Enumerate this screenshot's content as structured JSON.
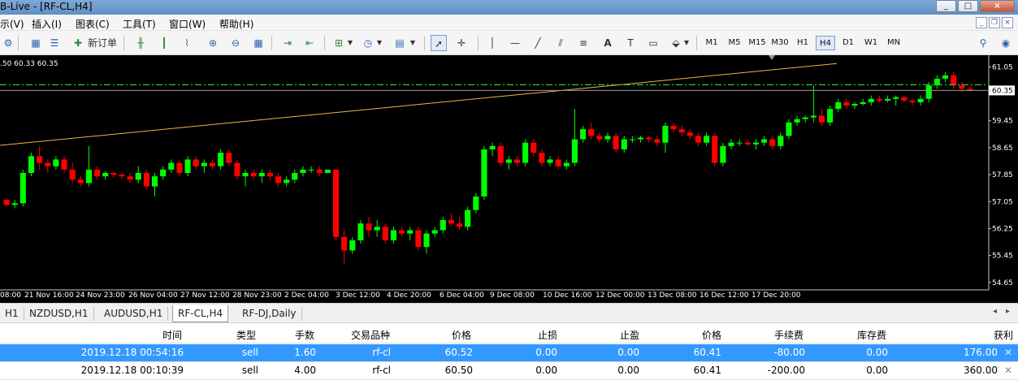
{
  "window": {
    "title": "B-Live - [RF-CL,H4]",
    "controls": [
      "_",
      "□",
      "×"
    ]
  },
  "menu": {
    "items": [
      "示(V)",
      "插入(I)",
      "图表(C)",
      "工具(T)",
      "窗口(W)",
      "帮助(H)"
    ]
  },
  "toolbar": {
    "new_order_label": "新订单",
    "timeframes": [
      "M1",
      "M5",
      "M15",
      "M30",
      "H1",
      "H4",
      "D1",
      "W1",
      "MN"
    ],
    "active_timeframe": "H4"
  },
  "chart": {
    "symbol": "RF-CL",
    "timeframe": "H4",
    "info_text": ".50 60.33 60.35",
    "current_price_label": "60.35",
    "y_ticks": [
      "61.05",
      "60.35",
      "59.45",
      "58.65",
      "57.85",
      "57.05",
      "56.25",
      "55.45",
      "54.65"
    ],
    "x_ticks": [
      "08:00",
      "21 Nov 16:00",
      "24 Nov 23:00",
      "26 Nov 04:00",
      "27 Nov 12:00",
      "28 Nov 23:00",
      "2 Dec 04:00",
      "3 Dec 12:00",
      "4 Dec 20:00",
      "6 Dec 04:00",
      "9 Dec 08:00",
      "10 Dec 16:00",
      "12 Dec 00:00",
      "13 Dec 08:00",
      "16 Dec 12:00",
      "17 Dec 20:00"
    ],
    "colors": {
      "background": "#000000",
      "bull": "#00ff00",
      "bear": "#ff0000",
      "trendline": "#e6b84a",
      "level_line": "#2ec72e"
    }
  },
  "chart_tabs": {
    "items": [
      "H1",
      "NZDUSD,H1",
      "AUDUSD,H1",
      "RF-CL,H4",
      "RF-DJ,Daily"
    ],
    "active": "RF-CL,H4"
  },
  "trades": {
    "columns": [
      "时间",
      "类型",
      "手数",
      "交易品种",
      "价格",
      "止损",
      "止盈",
      "价格",
      "手续费",
      "库存费",
      "获利"
    ],
    "rows": [
      {
        "time": "2019.12.18 00:54:16",
        "type": "sell",
        "lots": "1.60",
        "symbol": "rf-cl",
        "price": "60.52",
        "sl": "0.00",
        "tp": "0.00",
        "cur_price": "60.41",
        "commission": "-80.00",
        "swap": "0.00",
        "profit": "176.00"
      },
      {
        "time": "2019.12.18 00:10:39",
        "type": "sell",
        "lots": "4.00",
        "symbol": "rf-cl",
        "price": "60.50",
        "sl": "0.00",
        "tp": "0.00",
        "cur_price": "60.41",
        "commission": "-200.00",
        "swap": "0.00",
        "profit": "360.00"
      }
    ]
  },
  "chart_data": {
    "type": "candlestick",
    "symbol": "RF-CL",
    "timeframe": "H4",
    "ylim": [
      54.5,
      61.3
    ],
    "candles": [
      [
        57.1,
        57.15,
        56.9,
        56.95
      ],
      [
        56.95,
        57.1,
        56.85,
        57.0
      ],
      [
        57.0,
        58.0,
        56.9,
        57.9
      ],
      [
        57.9,
        58.5,
        57.8,
        58.4
      ],
      [
        58.4,
        58.7,
        58.0,
        58.2
      ],
      [
        58.2,
        58.3,
        57.9,
        58.1
      ],
      [
        58.1,
        58.4,
        58.0,
        58.3
      ],
      [
        58.3,
        58.4,
        57.9,
        58.0
      ],
      [
        58.0,
        58.2,
        57.6,
        57.7
      ],
      [
        57.7,
        57.8,
        57.5,
        57.6
      ],
      [
        57.6,
        58.7,
        57.5,
        58.0
      ],
      [
        58.0,
        58.1,
        57.7,
        57.8
      ],
      [
        57.8,
        57.95,
        57.7,
        57.9
      ],
      [
        57.9,
        57.95,
        57.75,
        57.85
      ],
      [
        57.85,
        57.9,
        57.7,
        57.8
      ],
      [
        57.8,
        57.9,
        57.6,
        57.7
      ],
      [
        57.7,
        58.1,
        57.6,
        57.9
      ],
      [
        57.9,
        58.0,
        57.4,
        57.5
      ],
      [
        57.5,
        57.9,
        57.2,
        57.8
      ],
      [
        57.8,
        58.1,
        57.7,
        58.0
      ],
      [
        58.0,
        58.3,
        57.9,
        58.2
      ],
      [
        58.2,
        58.3,
        57.8,
        57.9
      ],
      [
        57.9,
        58.4,
        57.8,
        58.3
      ],
      [
        58.3,
        58.4,
        58.0,
        58.1
      ],
      [
        58.1,
        58.3,
        57.9,
        58.2
      ],
      [
        58.2,
        58.3,
        58.0,
        58.1
      ],
      [
        58.1,
        58.6,
        58.0,
        58.5
      ],
      [
        58.5,
        58.6,
        58.1,
        58.2
      ],
      [
        58.2,
        58.3,
        57.7,
        57.8
      ],
      [
        57.8,
        58.0,
        57.5,
        57.9
      ],
      [
        57.9,
        58.0,
        57.7,
        57.8
      ],
      [
        57.8,
        58.0,
        57.6,
        57.9
      ],
      [
        57.9,
        58.0,
        57.7,
        57.8
      ],
      [
        57.8,
        57.9,
        57.5,
        57.6
      ],
      [
        57.6,
        57.8,
        57.5,
        57.7
      ],
      [
        57.7,
        58.0,
        57.6,
        57.9
      ],
      [
        57.9,
        58.1,
        57.8,
        58.0
      ],
      [
        58.0,
        58.1,
        57.9,
        58.0
      ],
      [
        58.0,
        58.1,
        57.8,
        57.9
      ],
      [
        57.9,
        58.0,
        57.9,
        58.0
      ],
      [
        58.0,
        58.0,
        55.9,
        56.0
      ],
      [
        56.0,
        56.2,
        55.2,
        55.6
      ],
      [
        55.6,
        56.0,
        55.5,
        55.9
      ],
      [
        55.9,
        56.5,
        55.8,
        56.4
      ],
      [
        56.4,
        56.6,
        56.0,
        56.2
      ],
      [
        56.2,
        56.5,
        56.0,
        56.3
      ],
      [
        56.3,
        56.4,
        55.8,
        55.9
      ],
      [
        55.9,
        56.3,
        55.8,
        56.2
      ],
      [
        56.2,
        56.3,
        56.0,
        56.1
      ],
      [
        56.1,
        56.3,
        55.9,
        56.2
      ],
      [
        56.2,
        56.3,
        55.6,
        55.7
      ],
      [
        55.7,
        56.2,
        55.5,
        56.1
      ],
      [
        56.1,
        56.3,
        56.0,
        56.2
      ],
      [
        56.2,
        56.6,
        56.1,
        56.5
      ],
      [
        56.5,
        56.7,
        56.3,
        56.4
      ],
      [
        56.4,
        56.6,
        56.2,
        56.3
      ],
      [
        56.3,
        56.9,
        56.2,
        56.8
      ],
      [
        56.8,
        57.3,
        56.7,
        57.2
      ],
      [
        57.2,
        58.7,
        57.1,
        58.6
      ],
      [
        58.6,
        58.8,
        58.4,
        58.7
      ],
      [
        58.7,
        58.8,
        58.1,
        58.2
      ],
      [
        58.2,
        58.4,
        58.0,
        58.3
      ],
      [
        58.3,
        58.4,
        58.1,
        58.2
      ],
      [
        58.2,
        58.9,
        58.1,
        58.8
      ],
      [
        58.8,
        58.9,
        58.4,
        58.5
      ],
      [
        58.5,
        58.6,
        58.1,
        58.2
      ],
      [
        58.2,
        58.4,
        58.1,
        58.3
      ],
      [
        58.3,
        58.4,
        58.0,
        58.1
      ],
      [
        58.1,
        58.3,
        58.0,
        58.2
      ],
      [
        58.2,
        59.8,
        58.1,
        58.9
      ],
      [
        58.9,
        59.3,
        58.8,
        59.2
      ],
      [
        59.2,
        59.4,
        58.9,
        59.0
      ],
      [
        59.0,
        59.1,
        58.8,
        58.9
      ],
      [
        58.9,
        59.1,
        58.8,
        59.0
      ],
      [
        59.0,
        59.1,
        58.5,
        58.6
      ],
      [
        58.6,
        59.0,
        58.5,
        58.9
      ],
      [
        58.9,
        59.0,
        58.8,
        58.9
      ],
      [
        58.9,
        59.0,
        58.8,
        58.95
      ],
      [
        58.95,
        59.0,
        58.8,
        58.9
      ],
      [
        58.9,
        59.0,
        58.7,
        58.8
      ],
      [
        58.8,
        59.4,
        58.5,
        59.3
      ],
      [
        59.3,
        59.4,
        59.1,
        59.2
      ],
      [
        59.2,
        59.3,
        59.0,
        59.1
      ],
      [
        59.1,
        59.2,
        58.9,
        59.0
      ],
      [
        59.0,
        59.1,
        58.7,
        58.8
      ],
      [
        58.8,
        59.1,
        58.7,
        59.0
      ],
      [
        59.0,
        59.1,
        58.1,
        58.2
      ],
      [
        58.2,
        58.8,
        58.1,
        58.7
      ],
      [
        58.7,
        58.9,
        58.6,
        58.8
      ],
      [
        58.8,
        58.9,
        58.7,
        58.8
      ],
      [
        58.8,
        58.9,
        58.7,
        58.75
      ],
      [
        58.75,
        58.9,
        58.6,
        58.8
      ],
      [
        58.8,
        59.0,
        58.7,
        58.9
      ],
      [
        58.9,
        59.0,
        58.6,
        58.7
      ],
      [
        58.7,
        59.1,
        58.6,
        59.0
      ],
      [
        59.0,
        59.5,
        58.9,
        59.4
      ],
      [
        59.4,
        59.6,
        59.3,
        59.5
      ],
      [
        59.5,
        59.6,
        59.4,
        59.55
      ],
      [
        59.55,
        60.5,
        59.4,
        59.6
      ],
      [
        59.6,
        59.8,
        59.3,
        59.4
      ],
      [
        59.4,
        59.9,
        59.3,
        59.8
      ],
      [
        59.8,
        60.1,
        59.7,
        60.0
      ],
      [
        60.0,
        60.1,
        59.8,
        59.9
      ],
      [
        59.9,
        60.0,
        59.8,
        59.95
      ],
      [
        59.95,
        60.1,
        59.9,
        60.0
      ],
      [
        60.0,
        60.2,
        59.9,
        60.1
      ],
      [
        60.1,
        60.2,
        60.0,
        60.05
      ],
      [
        60.05,
        60.2,
        60.0,
        60.1
      ],
      [
        60.1,
        60.2,
        59.9,
        60.15
      ],
      [
        60.15,
        60.2,
        60.0,
        60.05
      ],
      [
        60.05,
        60.1,
        59.9,
        60.0
      ],
      [
        60.0,
        60.2,
        59.9,
        60.1
      ],
      [
        60.1,
        60.6,
        60.0,
        60.5
      ],
      [
        60.5,
        60.8,
        60.4,
        60.7
      ],
      [
        60.7,
        60.9,
        60.6,
        60.8
      ],
      [
        60.8,
        60.9,
        60.4,
        60.5
      ],
      [
        60.5,
        60.6,
        60.3,
        60.4
      ],
      [
        60.4,
        60.5,
        60.3,
        60.35
      ]
    ]
  }
}
